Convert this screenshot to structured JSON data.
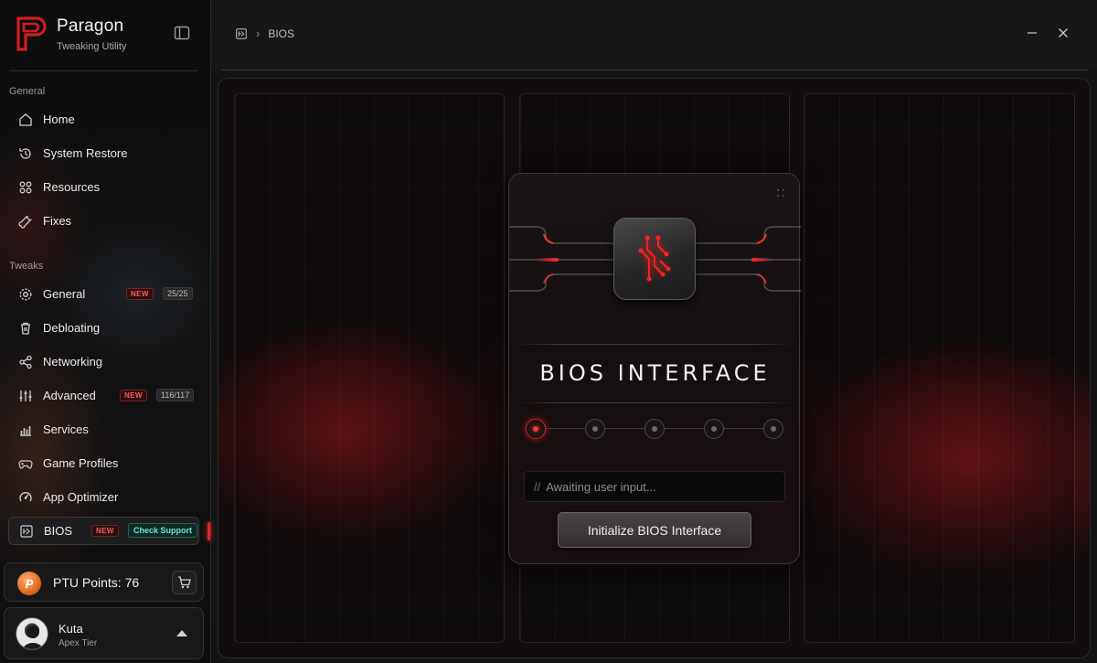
{
  "app": {
    "name": "Paragon",
    "subtitle": "Tweaking Utility"
  },
  "sidebar": {
    "sections": [
      {
        "label": "General"
      },
      {
        "label": "Tweaks"
      }
    ],
    "general_items": [
      {
        "label": "Home",
        "icon": "home-icon"
      },
      {
        "label": "System Restore",
        "icon": "restore-icon"
      },
      {
        "label": "Resources",
        "icon": "resources-icon"
      },
      {
        "label": "Fixes",
        "icon": "wrench-icon"
      }
    ],
    "tweak_items": [
      {
        "label": "General",
        "icon": "gear-icon",
        "badge_new": "NEW",
        "count": "25/25"
      },
      {
        "label": "Debloating",
        "icon": "trash-icon"
      },
      {
        "label": "Networking",
        "icon": "share-icon"
      },
      {
        "label": "Advanced",
        "icon": "sliders-icon",
        "badge_new": "NEW",
        "count": "116/117"
      },
      {
        "label": "Services",
        "icon": "bar-chart-icon"
      },
      {
        "label": "Game Profiles",
        "icon": "gamepad-icon"
      },
      {
        "label": "App Optimizer",
        "icon": "optimizer-icon"
      },
      {
        "label": "BIOS",
        "icon": "bios-icon",
        "badge_new": "NEW",
        "support": "Check Support",
        "active": true
      }
    ],
    "points": {
      "label": "PTU Points: 76",
      "coin_letter": "P"
    },
    "user": {
      "name": "Kuta",
      "tier": "Apex Tier"
    }
  },
  "header": {
    "breadcrumb": "BIOS"
  },
  "bios": {
    "title": "BIOS INTERFACE",
    "steps_total": 5,
    "active_step": 1,
    "console_prefix": "//",
    "console_text": "Awaiting user input...",
    "button_label": "Initialize BIOS Interface"
  },
  "colors": {
    "accent": "#e02424",
    "support_badge": "#6ee8c8",
    "background": "#141414"
  }
}
